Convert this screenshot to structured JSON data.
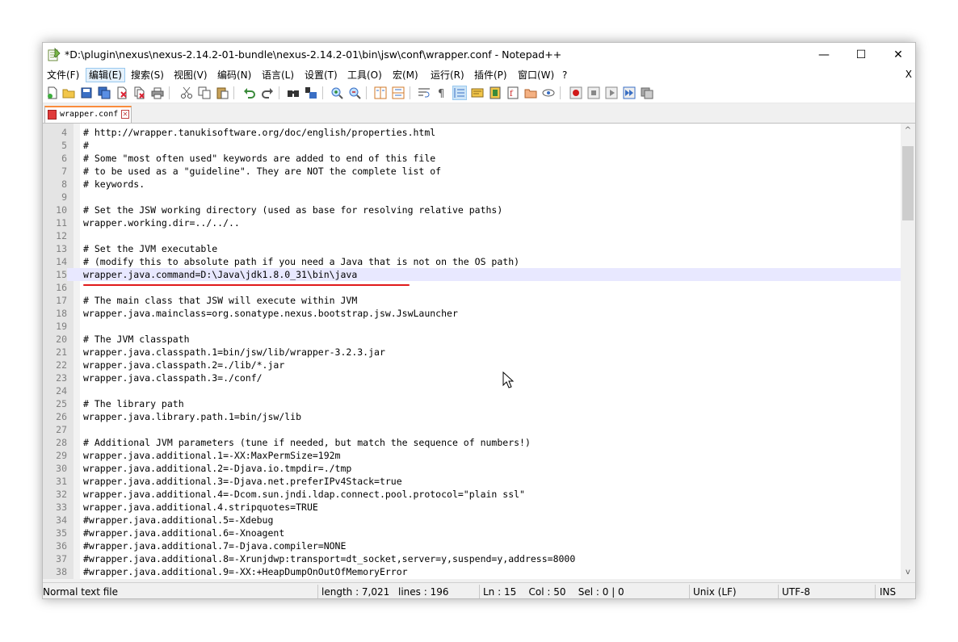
{
  "window": {
    "title": "*D:\\plugin\\nexus\\nexus-2.14.2-01-bundle\\nexus-2.14.2-01\\bin\\jsw\\conf\\wrapper.conf - Notepad++",
    "minimize": "—",
    "maximize": "☐",
    "close": "✕"
  },
  "menu": {
    "items": [
      "文件(F)",
      "编辑(E)",
      "搜索(S)",
      "视图(V)",
      "编码(N)",
      "语言(L)",
      "设置(T)",
      "工具(O)",
      "宏(M)",
      "运行(R)",
      "插件(P)",
      "窗口(W)",
      "?"
    ],
    "close_doc": "X"
  },
  "toolbar_icons": [
    "new-file-icon",
    "open-file-icon",
    "save-icon",
    "save-all-icon",
    "close-icon",
    "close-all-icon",
    "print-icon",
    "cut-icon",
    "copy-icon",
    "paste-icon",
    "undo-icon",
    "redo-icon",
    "find-icon",
    "replace-icon",
    "zoom-in-icon",
    "zoom-out-icon",
    "sync-vertical-icon",
    "sync-horizontal-icon",
    "word-wrap-icon",
    "show-all-chars-icon",
    "indent-guide-icon",
    "udl-icon",
    "doc-map-icon",
    "function-list-icon",
    "folder-workspace-icon",
    "monitor-icon",
    "record-macro-icon",
    "stop-record-icon",
    "play-macro-icon",
    "run-macro-multiple-icon",
    "save-macro-icon"
  ],
  "tab": {
    "label": "wrapper.conf"
  },
  "editor": {
    "lines": [
      {
        "n": "4",
        "t": "# http://wrapper.tanukisoftware.org/doc/english/properties.html"
      },
      {
        "n": "5",
        "t": "#"
      },
      {
        "n": "6",
        "t": "# Some \"most often used\" keywords are added to end of this file"
      },
      {
        "n": "7",
        "t": "# to be used as a \"guideline\". They are NOT the complete list of"
      },
      {
        "n": "8",
        "t": "# keywords."
      },
      {
        "n": "9",
        "t": ""
      },
      {
        "n": "10",
        "t": "# Set the JSW working directory (used as base for resolving relative paths)"
      },
      {
        "n": "11",
        "t": "wrapper.working.dir=../../.."
      },
      {
        "n": "12",
        "t": ""
      },
      {
        "n": "13",
        "t": "# Set the JVM executable"
      },
      {
        "n": "14",
        "t": "# (modify this to absolute path if you need a Java that is not on the OS path)"
      },
      {
        "n": "15",
        "t": "wrapper.java.command=D:\\Java\\jdk1.8.0_31\\bin\\java"
      },
      {
        "n": "16",
        "t": ""
      },
      {
        "n": "17",
        "t": "# The main class that JSW will execute within JVM"
      },
      {
        "n": "18",
        "t": "wrapper.java.mainclass=org.sonatype.nexus.bootstrap.jsw.JswLauncher"
      },
      {
        "n": "19",
        "t": ""
      },
      {
        "n": "20",
        "t": "# The JVM classpath"
      },
      {
        "n": "21",
        "t": "wrapper.java.classpath.1=bin/jsw/lib/wrapper-3.2.3.jar"
      },
      {
        "n": "22",
        "t": "wrapper.java.classpath.2=./lib/*.jar"
      },
      {
        "n": "23",
        "t": "wrapper.java.classpath.3=./conf/"
      },
      {
        "n": "24",
        "t": ""
      },
      {
        "n": "25",
        "t": "# The library path"
      },
      {
        "n": "26",
        "t": "wrapper.java.library.path.1=bin/jsw/lib"
      },
      {
        "n": "27",
        "t": ""
      },
      {
        "n": "28",
        "t": "# Additional JVM parameters (tune if needed, but match the sequence of numbers!)"
      },
      {
        "n": "29",
        "t": "wrapper.java.additional.1=-XX:MaxPermSize=192m"
      },
      {
        "n": "30",
        "t": "wrapper.java.additional.2=-Djava.io.tmpdir=./tmp"
      },
      {
        "n": "31",
        "t": "wrapper.java.additional.3=-Djava.net.preferIPv4Stack=true"
      },
      {
        "n": "32",
        "t": "wrapper.java.additional.4=-Dcom.sun.jndi.ldap.connect.pool.protocol=\"plain ssl\""
      },
      {
        "n": "33",
        "t": "wrapper.java.additional.4.stripquotes=TRUE"
      },
      {
        "n": "34",
        "t": "#wrapper.java.additional.5=-Xdebug"
      },
      {
        "n": "35",
        "t": "#wrapper.java.additional.6=-Xnoagent"
      },
      {
        "n": "36",
        "t": "#wrapper.java.additional.7=-Djava.compiler=NONE"
      },
      {
        "n": "37",
        "t": "#wrapper.java.additional.8=-Xrunjdwp:transport=dt_socket,server=y,suspend=y,address=8000"
      },
      {
        "n": "38",
        "t": "#wrapper.java.additional.9=-XX:+HeapDumpOnOutOfMemoryError"
      }
    ],
    "current_line": "15"
  },
  "scrollbar": {
    "up": "^",
    "down": "v"
  },
  "status": {
    "type": "Normal text file",
    "length": "length : 7,021",
    "lines": "lines : 196",
    "position": "Ln : 15    Col : 50    Sel : 0 | 0",
    "eol": "Unix (LF)",
    "encoding": "UTF-8",
    "mode": "INS"
  }
}
